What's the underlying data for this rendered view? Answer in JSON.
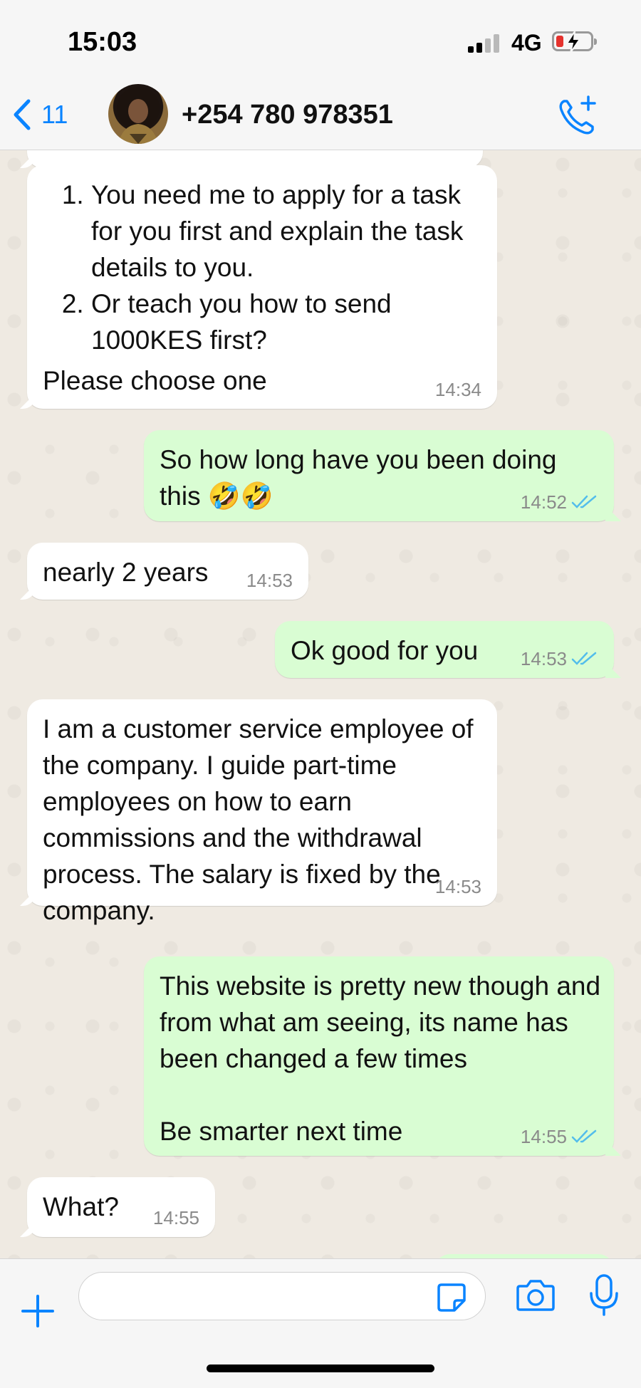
{
  "status_bar": {
    "time": "15:03",
    "network": "4G",
    "battery_level": 0.15,
    "battery_color": "#e5322d"
  },
  "header": {
    "back_count": "11",
    "contact_name": "+254 780 978351",
    "back_icon": "chevron-left-icon",
    "call_icon": "add-call-icon",
    "accent_color": "#0a84ff"
  },
  "messages": [
    {
      "direction": "incoming",
      "list_items": [
        "You need me to apply for a task for you first and explain the task details to you.",
        "Or teach you how to send 1000KES first?"
      ],
      "text": "Please choose one",
      "time": "14:34"
    },
    {
      "direction": "outgoing",
      "text": "So how long have you been doing this 🤣🤣",
      "time": "14:52",
      "status": "read"
    },
    {
      "direction": "incoming",
      "text": "nearly 2 years",
      "time": "14:53"
    },
    {
      "direction": "outgoing",
      "text": "Ok good for you",
      "time": "14:53",
      "status": "read"
    },
    {
      "direction": "incoming",
      "text": "I am a customer service employee of the company. I guide part-time employees on how to earn commissions and the withdrawal process. The salary is fixed by the company.",
      "time": "14:53"
    },
    {
      "direction": "outgoing",
      "text": "This website is pretty new though and from what am seeing, its name has been changed a few times",
      "text2": "Be smarter next time",
      "time": "14:55",
      "status": "read"
    },
    {
      "direction": "incoming",
      "text": "What?",
      "time": "14:55"
    }
  ],
  "input_bar": {
    "placeholder": "",
    "icons": [
      "plus-icon",
      "sticker-icon",
      "camera-icon",
      "microphone-icon"
    ]
  },
  "colors": {
    "incoming_bubble": "#ffffff",
    "outgoing_bubble": "#d9fdd3",
    "read_ticks": "#53bdeb",
    "chat_background": "#efeae2"
  }
}
